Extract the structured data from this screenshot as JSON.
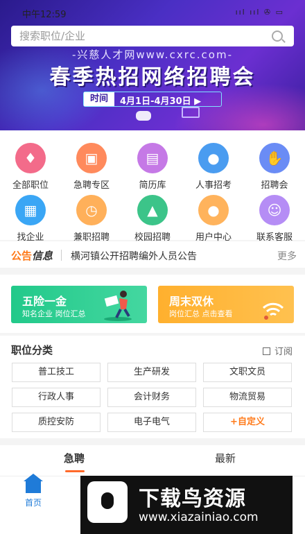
{
  "status_bar": {
    "time": "中午12:59",
    "signal": "ııl ııl ✇ ▭"
  },
  "search": {
    "placeholder": "搜索职位/企业"
  },
  "banner": {
    "site": "-兴慈人才网www.cxrc.com-",
    "headline": "春季热招网络招聘会",
    "time_label": "时间",
    "time_value": "4月1日-4月30日 ▶"
  },
  "grid": [
    {
      "label": "全部职位",
      "icon": "tie-icon",
      "color": "#f36b8a"
    },
    {
      "label": "急聘专区",
      "icon": "briefcase-icon",
      "color": "#ff8a5c"
    },
    {
      "label": "简历库",
      "icon": "resume-icon",
      "color": "#c579e6"
    },
    {
      "label": "人事招考",
      "icon": "person-icon",
      "color": "#4a9cf0"
    },
    {
      "label": "招聘会",
      "icon": "handshake-icon",
      "color": "#6a8cf5"
    },
    {
      "label": "找企业",
      "icon": "document-icon",
      "color": "#3aa6f5"
    },
    {
      "label": "兼职招聘",
      "icon": "clock-icon",
      "color": "#ffb05a"
    },
    {
      "label": "校园招聘",
      "icon": "graduation-cap-icon",
      "color": "#3cc489"
    },
    {
      "label": "用户中心",
      "icon": "user-icon",
      "color": "#ffb35c"
    },
    {
      "label": "联系客服",
      "icon": "headset-icon",
      "color": "#b58df5"
    }
  ],
  "notice": {
    "tag1": "公告",
    "tag2": "信息",
    "text": "横河镇公开招聘编外人员公告",
    "more": "更多"
  },
  "promos": [
    {
      "title": "五险一金",
      "sub": "知名企业  岗位汇总"
    },
    {
      "title": "周末双休",
      "sub": "岗位汇总  点击查看"
    }
  ],
  "categories": {
    "title": "职位分类",
    "subscribe": "订阅",
    "items": [
      "普工技工",
      "生产研发",
      "文职文员",
      "行政人事",
      "会计财务",
      "物流贸易",
      "质控安防",
      "电子电气",
      "+自定义"
    ]
  },
  "tabs": [
    "急聘",
    "最新"
  ],
  "bottom_nav": {
    "home": "首页"
  },
  "watermark": {
    "title": "下载鸟资源",
    "url": "www.xiazainiao.com"
  }
}
